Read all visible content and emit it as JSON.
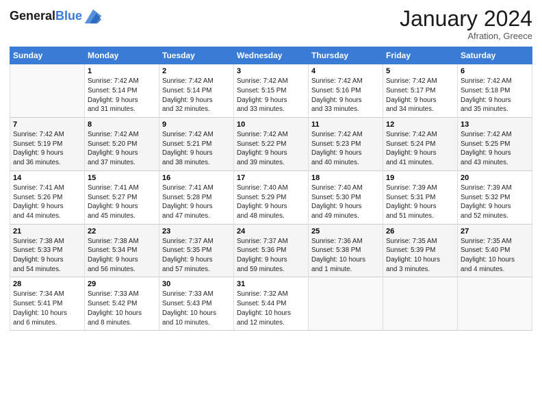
{
  "header": {
    "logo_line1": "General",
    "logo_line2": "Blue",
    "month": "January 2024",
    "location": "Afration, Greece"
  },
  "columns": [
    "Sunday",
    "Monday",
    "Tuesday",
    "Wednesday",
    "Thursday",
    "Friday",
    "Saturday"
  ],
  "weeks": [
    [
      {
        "num": "",
        "info": ""
      },
      {
        "num": "1",
        "info": "Sunrise: 7:42 AM\nSunset: 5:14 PM\nDaylight: 9 hours\nand 31 minutes."
      },
      {
        "num": "2",
        "info": "Sunrise: 7:42 AM\nSunset: 5:14 PM\nDaylight: 9 hours\nand 32 minutes."
      },
      {
        "num": "3",
        "info": "Sunrise: 7:42 AM\nSunset: 5:15 PM\nDaylight: 9 hours\nand 33 minutes."
      },
      {
        "num": "4",
        "info": "Sunrise: 7:42 AM\nSunset: 5:16 PM\nDaylight: 9 hours\nand 33 minutes."
      },
      {
        "num": "5",
        "info": "Sunrise: 7:42 AM\nSunset: 5:17 PM\nDaylight: 9 hours\nand 34 minutes."
      },
      {
        "num": "6",
        "info": "Sunrise: 7:42 AM\nSunset: 5:18 PM\nDaylight: 9 hours\nand 35 minutes."
      }
    ],
    [
      {
        "num": "7",
        "info": "Sunrise: 7:42 AM\nSunset: 5:19 PM\nDaylight: 9 hours\nand 36 minutes."
      },
      {
        "num": "8",
        "info": "Sunrise: 7:42 AM\nSunset: 5:20 PM\nDaylight: 9 hours\nand 37 minutes."
      },
      {
        "num": "9",
        "info": "Sunrise: 7:42 AM\nSunset: 5:21 PM\nDaylight: 9 hours\nand 38 minutes."
      },
      {
        "num": "10",
        "info": "Sunrise: 7:42 AM\nSunset: 5:22 PM\nDaylight: 9 hours\nand 39 minutes."
      },
      {
        "num": "11",
        "info": "Sunrise: 7:42 AM\nSunset: 5:23 PM\nDaylight: 9 hours\nand 40 minutes."
      },
      {
        "num": "12",
        "info": "Sunrise: 7:42 AM\nSunset: 5:24 PM\nDaylight: 9 hours\nand 41 minutes."
      },
      {
        "num": "13",
        "info": "Sunrise: 7:42 AM\nSunset: 5:25 PM\nDaylight: 9 hours\nand 43 minutes."
      }
    ],
    [
      {
        "num": "14",
        "info": "Sunrise: 7:41 AM\nSunset: 5:26 PM\nDaylight: 9 hours\nand 44 minutes."
      },
      {
        "num": "15",
        "info": "Sunrise: 7:41 AM\nSunset: 5:27 PM\nDaylight: 9 hours\nand 45 minutes."
      },
      {
        "num": "16",
        "info": "Sunrise: 7:41 AM\nSunset: 5:28 PM\nDaylight: 9 hours\nand 47 minutes."
      },
      {
        "num": "17",
        "info": "Sunrise: 7:40 AM\nSunset: 5:29 PM\nDaylight: 9 hours\nand 48 minutes."
      },
      {
        "num": "18",
        "info": "Sunrise: 7:40 AM\nSunset: 5:30 PM\nDaylight: 9 hours\nand 49 minutes."
      },
      {
        "num": "19",
        "info": "Sunrise: 7:39 AM\nSunset: 5:31 PM\nDaylight: 9 hours\nand 51 minutes."
      },
      {
        "num": "20",
        "info": "Sunrise: 7:39 AM\nSunset: 5:32 PM\nDaylight: 9 hours\nand 52 minutes."
      }
    ],
    [
      {
        "num": "21",
        "info": "Sunrise: 7:38 AM\nSunset: 5:33 PM\nDaylight: 9 hours\nand 54 minutes."
      },
      {
        "num": "22",
        "info": "Sunrise: 7:38 AM\nSunset: 5:34 PM\nDaylight: 9 hours\nand 56 minutes."
      },
      {
        "num": "23",
        "info": "Sunrise: 7:37 AM\nSunset: 5:35 PM\nDaylight: 9 hours\nand 57 minutes."
      },
      {
        "num": "24",
        "info": "Sunrise: 7:37 AM\nSunset: 5:36 PM\nDaylight: 9 hours\nand 59 minutes."
      },
      {
        "num": "25",
        "info": "Sunrise: 7:36 AM\nSunset: 5:38 PM\nDaylight: 10 hours\nand 1 minute."
      },
      {
        "num": "26",
        "info": "Sunrise: 7:35 AM\nSunset: 5:39 PM\nDaylight: 10 hours\nand 3 minutes."
      },
      {
        "num": "27",
        "info": "Sunrise: 7:35 AM\nSunset: 5:40 PM\nDaylight: 10 hours\nand 4 minutes."
      }
    ],
    [
      {
        "num": "28",
        "info": "Sunrise: 7:34 AM\nSunset: 5:41 PM\nDaylight: 10 hours\nand 6 minutes."
      },
      {
        "num": "29",
        "info": "Sunrise: 7:33 AM\nSunset: 5:42 PM\nDaylight: 10 hours\nand 8 minutes."
      },
      {
        "num": "30",
        "info": "Sunrise: 7:33 AM\nSunset: 5:43 PM\nDaylight: 10 hours\nand 10 minutes."
      },
      {
        "num": "31",
        "info": "Sunrise: 7:32 AM\nSunset: 5:44 PM\nDaylight: 10 hours\nand 12 minutes."
      },
      {
        "num": "",
        "info": ""
      },
      {
        "num": "",
        "info": ""
      },
      {
        "num": "",
        "info": ""
      }
    ]
  ]
}
